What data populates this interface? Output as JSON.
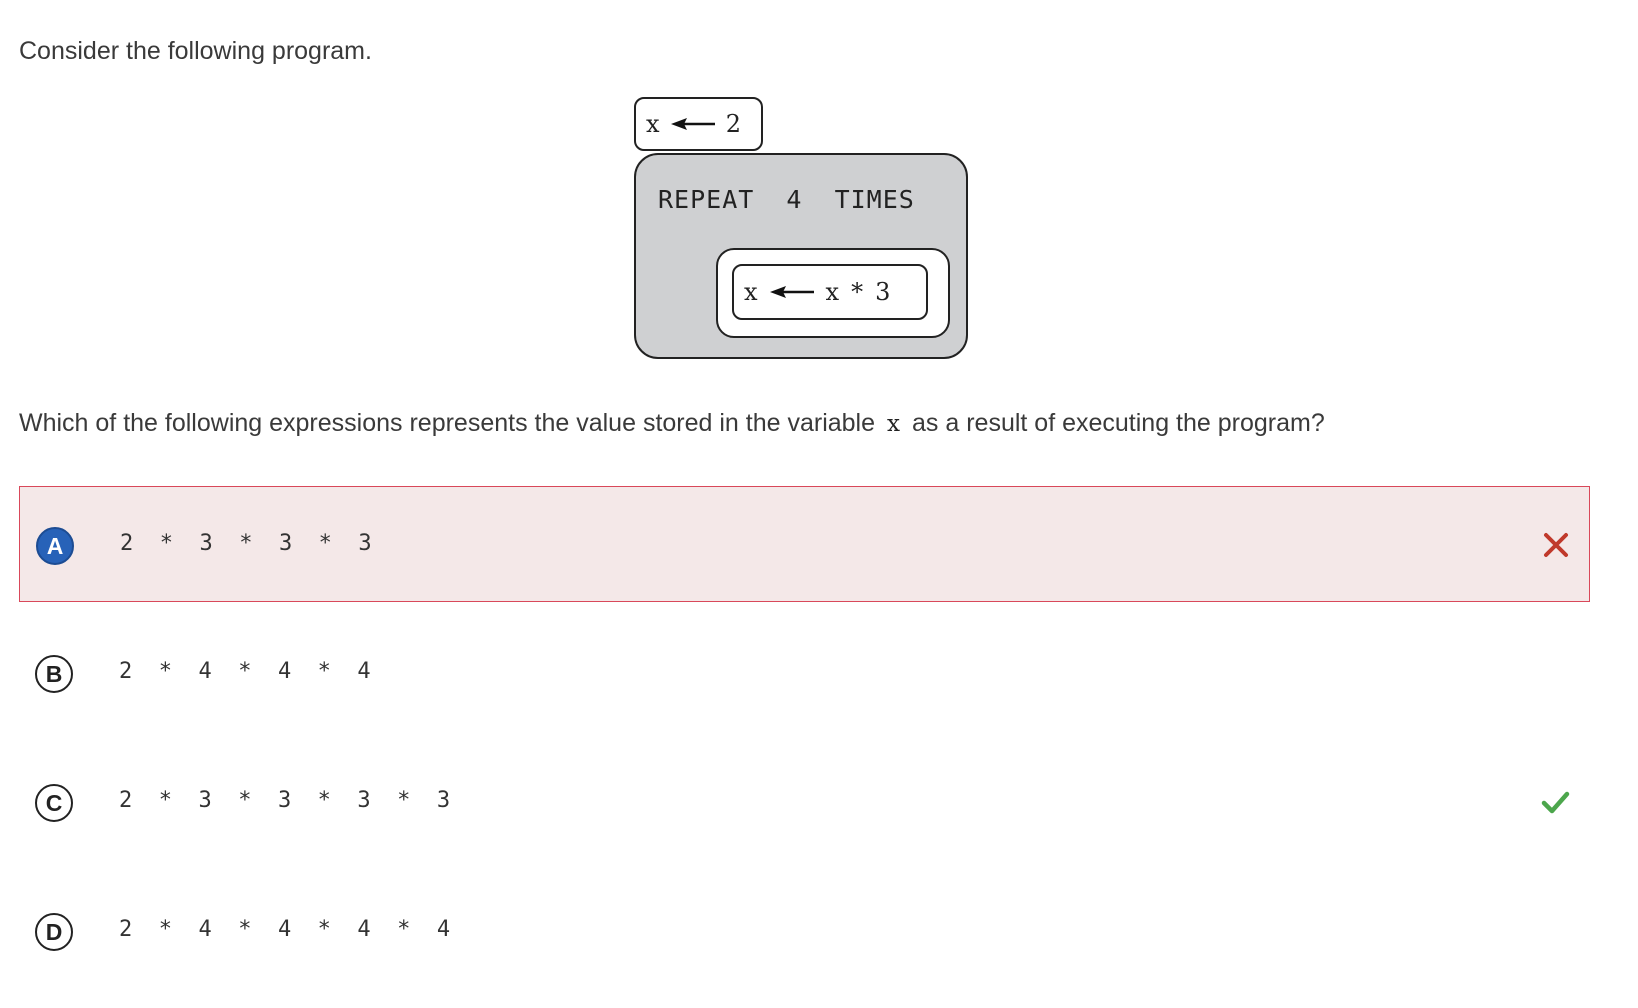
{
  "prompt": "Consider the following program.",
  "program": {
    "assign": {
      "var": "x",
      "value": "2"
    },
    "repeat_label": "REPEAT  4  TIMES",
    "inner": {
      "var": "x",
      "expr_var": "x",
      "op": "*",
      "operand": "3"
    }
  },
  "question": {
    "before": "Which of the following expressions represents the value stored in the variable",
    "code": "x",
    "after": "as a result of executing the program?"
  },
  "options": [
    {
      "letter": "A",
      "text": "2  *  3  *  3  *  3",
      "state": "selected-incorrect"
    },
    {
      "letter": "B",
      "text": "2  *  4  *  4  *  4",
      "state": "none"
    },
    {
      "letter": "C",
      "text": "2  *  3  *  3  *  3  *  3",
      "state": "correct"
    },
    {
      "letter": "D",
      "text": "2  *  4  *  4  *  4  *  4",
      "state": "none"
    }
  ],
  "colors": {
    "wrong_bg": "#f4e8e8",
    "wrong_border": "#d9485a",
    "wrong_mark": "#c0392b",
    "correct_mark": "#4ca64c",
    "selected_letter": "#2762b8",
    "repeat_block": "#cfd0d2"
  },
  "icons": {
    "wrong": "x-mark-icon",
    "correct": "check-mark-icon"
  }
}
